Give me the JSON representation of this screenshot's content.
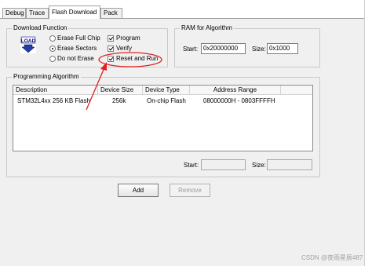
{
  "tabs": [
    "Debug",
    "Trace",
    "Flash Download",
    "Pack"
  ],
  "download_function": {
    "legend": "Download Function",
    "icon_text": "LOAD",
    "radios": [
      "Erase Full Chip",
      "Erase Sectors",
      "Do not Erase"
    ],
    "checks": [
      "Program",
      "Verify",
      "Reset and Run"
    ]
  },
  "ram": {
    "legend": "RAM for Algorithm",
    "start_label": "Start:",
    "start_value": "0x20000000",
    "size_label": "Size:",
    "size_value": "0x1000"
  },
  "programming_algorithm": {
    "legend": "Programming Algorithm",
    "columns": [
      "Description",
      "Device Size",
      "Device Type",
      "Address Range"
    ],
    "rows": [
      [
        "STM32L4xx 256 KB Flash",
        "256k",
        "On-chip Flash",
        "08000000H - 0803FFFFH"
      ]
    ],
    "start_label": "Start:",
    "size_label": "Size:"
  },
  "buttons": {
    "add": "Add",
    "remove": "Remove"
  },
  "watermark": "CSDN @夜雨星辰487",
  "colors": {
    "annotation": "#e02020",
    "panel": "#f0f0f0",
    "selection_border": "#7a7a7a"
  }
}
